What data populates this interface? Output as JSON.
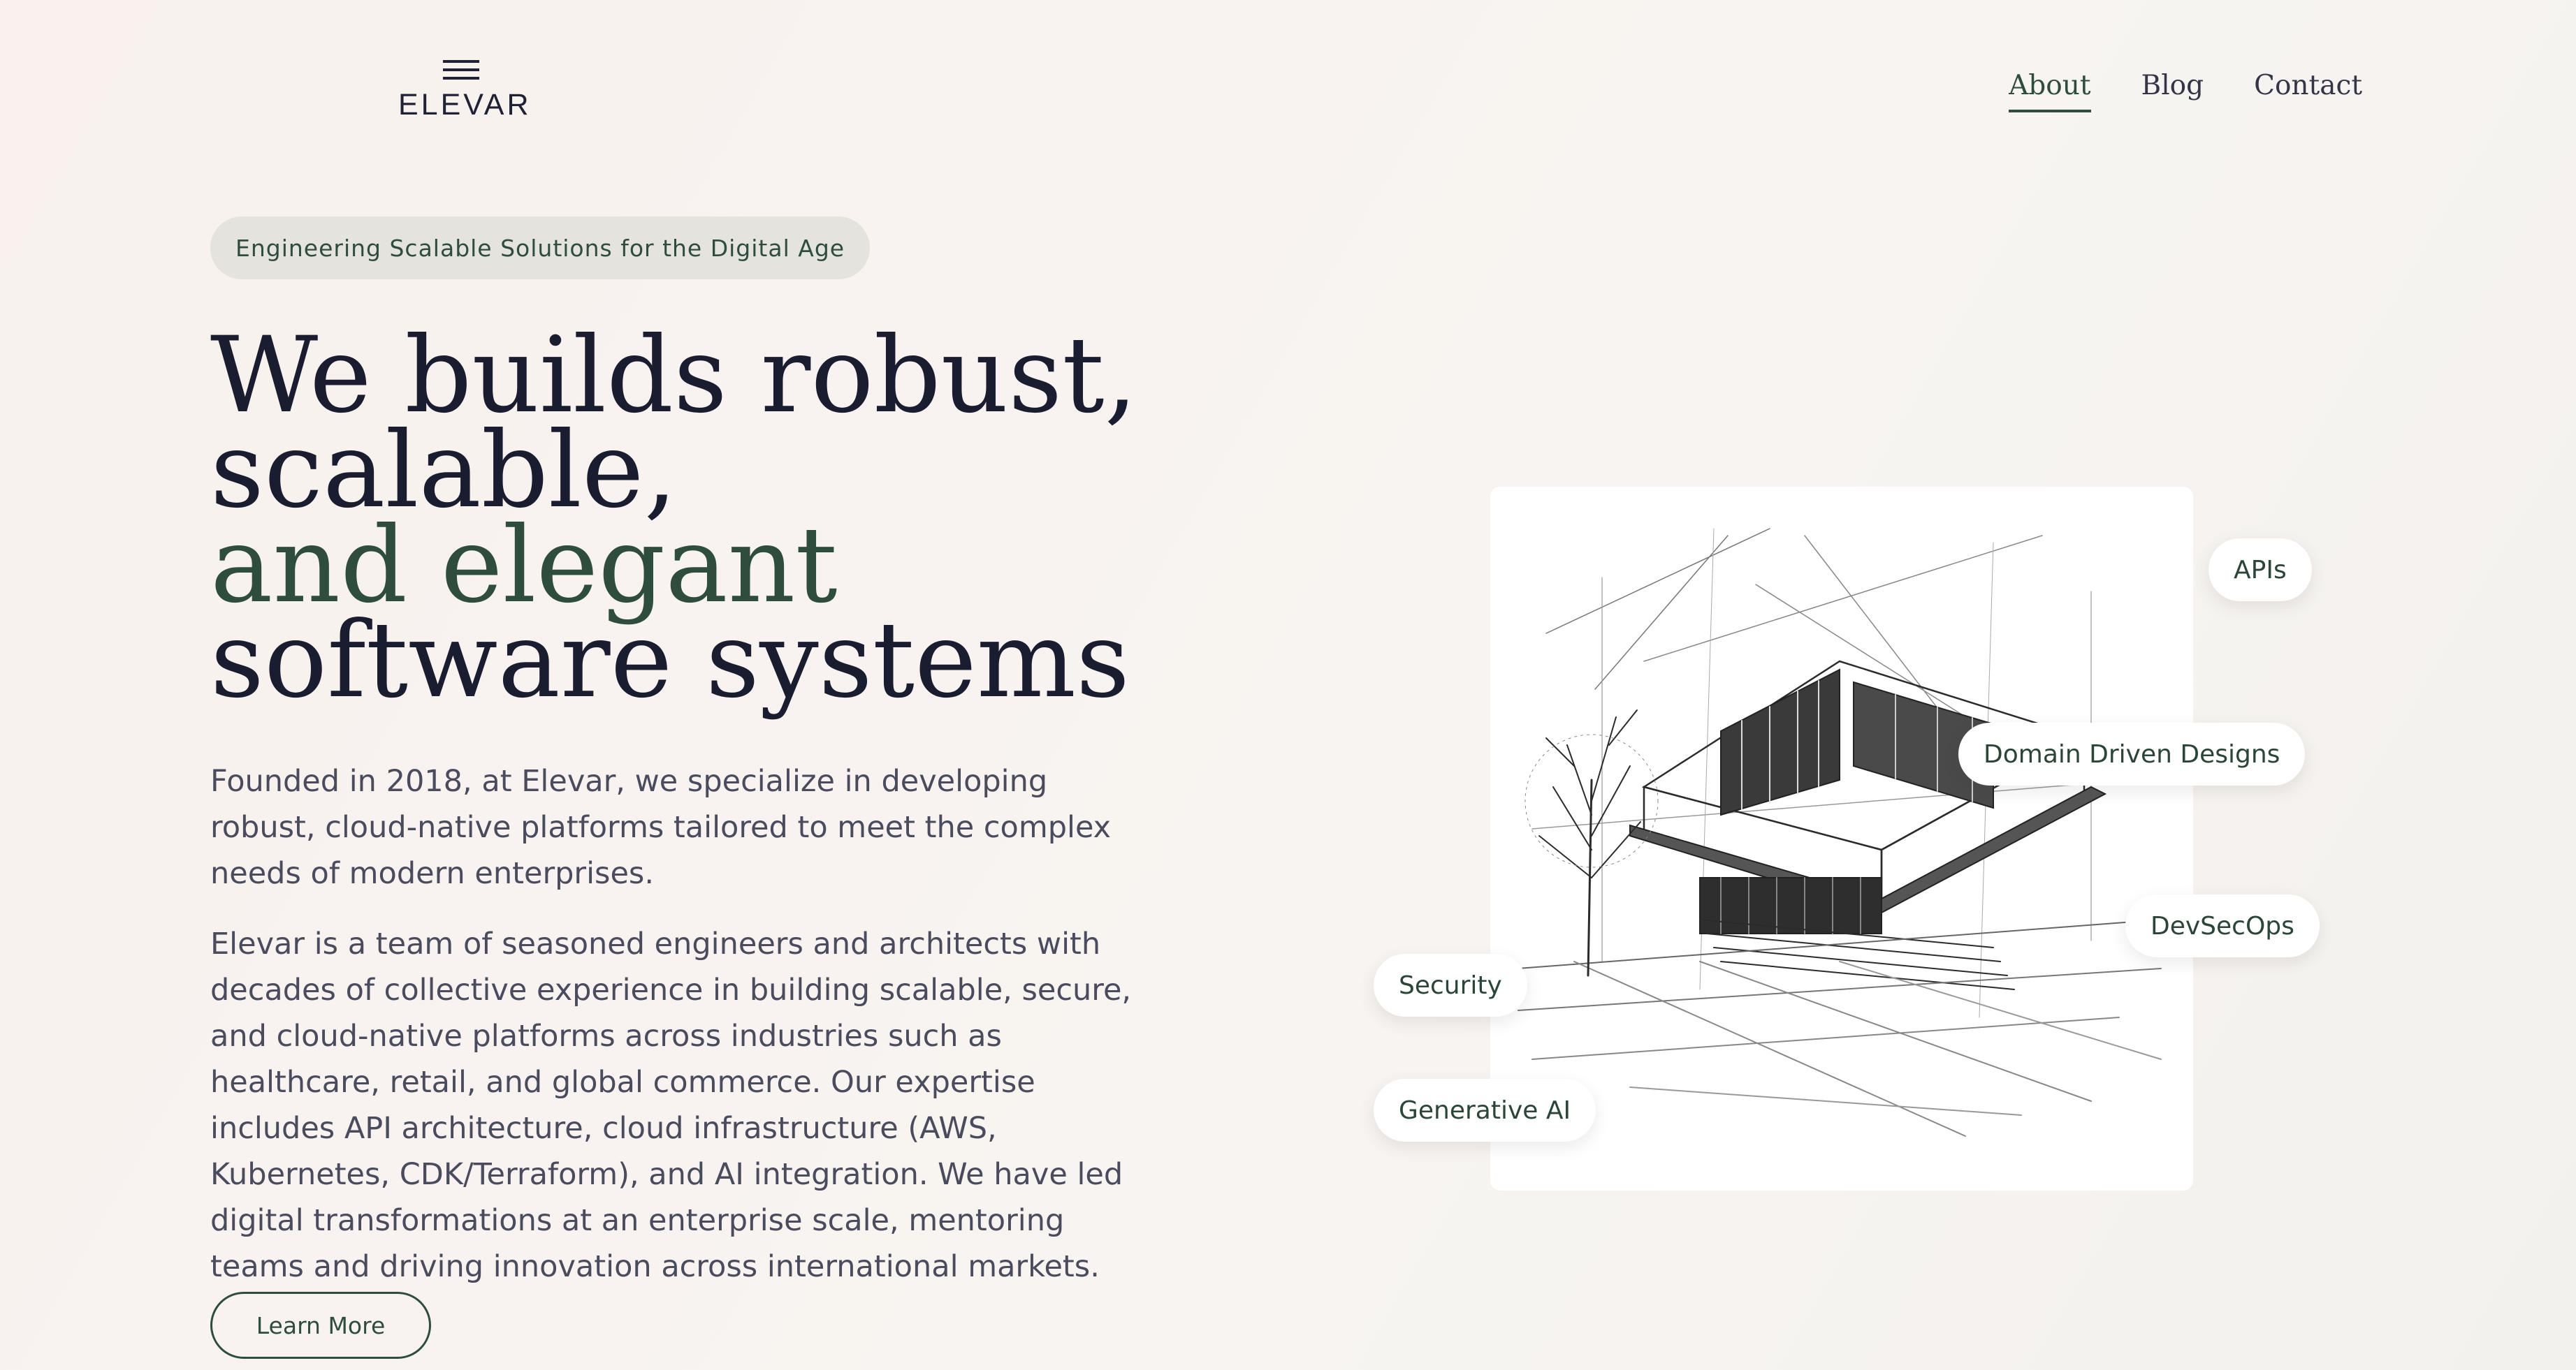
{
  "brand": {
    "name": "ELEVAR",
    "logo_icon": "hamburger-lines-icon"
  },
  "nav": {
    "items": [
      {
        "label": "About",
        "active": true
      },
      {
        "label": "Blog",
        "active": false
      },
      {
        "label": "Contact",
        "active": false
      }
    ]
  },
  "hero": {
    "tagline": "Engineering Scalable Solutions for the Digital Age",
    "headline": {
      "line1": "We builds robust,",
      "line2": "scalable,",
      "line3": "and elegant",
      "line4": "software systems"
    },
    "paragraph1": "Founded in 2018, at Elevar, we specialize in developing robust, cloud-native platforms tailored to meet the complex needs of modern enterprises.",
    "paragraph2": "Elevar is a team of seasoned engineers and architects with decades of collective experience in building scalable, secure, and cloud-native platforms across industries such as healthcare, retail, and global commerce. Our expertise includes API architecture, cloud infrastructure (AWS, Kubernetes, CDK/Terraform), and AI integration. We have led digital transformations at an enterprise scale, mentoring teams and driving innovation across international markets.",
    "cta_label": "Learn More"
  },
  "illustration": {
    "chips": {
      "apis": "APIs",
      "ddd": "Domain Driven Designs",
      "devsecops": "DevSecOps",
      "security": "Security",
      "genai": "Generative AI"
    }
  },
  "colors": {
    "background": "#f8f2ef",
    "ink": "#1a1d30",
    "accent_green": "#2e4d3d",
    "tagline_bg": "#e4e3de",
    "body_text": "#4a4c5e"
  }
}
